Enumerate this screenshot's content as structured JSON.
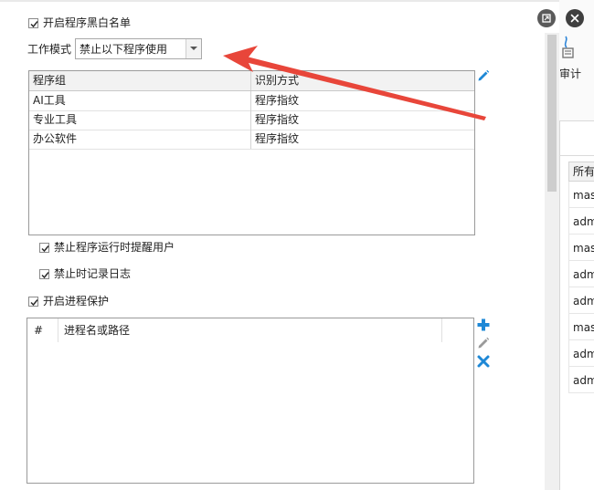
{
  "blacklist": {
    "enable_label": "开启程序黑白名单",
    "enable_checked": true,
    "mode_label": "工作模式",
    "mode_value": "禁止以下程序使用",
    "table": {
      "headers": [
        "程序组",
        "识别方式"
      ],
      "rows": [
        [
          "AI工具",
          "程序指纹"
        ],
        [
          "专业工具",
          "程序指纹"
        ],
        [
          "办公软件",
          "程序指纹"
        ]
      ]
    },
    "notify_label": "禁止程序运行时提醒用户",
    "notify_checked": true,
    "log_label": "禁止时记录日志",
    "log_checked": true
  },
  "process_protection": {
    "enable_label": "开启进程保护",
    "enable_checked": true,
    "table": {
      "headers": [
        "#",
        "进程名或路径"
      ],
      "rows": []
    }
  },
  "background_app": {
    "toolbar_label": "审计",
    "column_header": "所有",
    "rows": [
      "mas",
      "adm",
      "mas",
      "adm",
      "adm",
      "mas",
      "adm",
      "adm"
    ]
  },
  "colors": {
    "annotation_arrow": "#e8463a",
    "icon_blue": "#1e88d6",
    "checkmark": "#2b2b2b"
  },
  "icons": [
    "edit-icon",
    "add-icon",
    "edit-icon",
    "delete-icon",
    "dropdown-arrow-icon",
    "close-icon",
    "restore-icon"
  ]
}
